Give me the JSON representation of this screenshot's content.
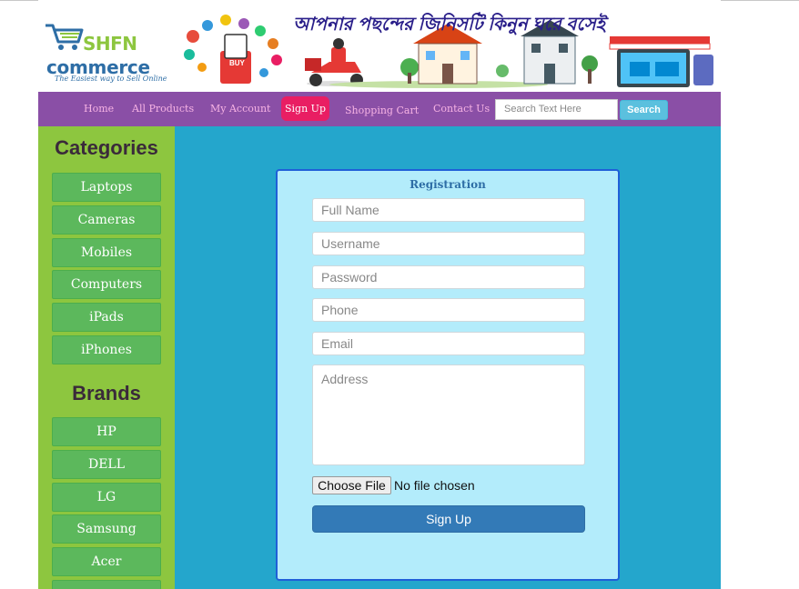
{
  "header": {
    "logo": {
      "brand_top": "SHFN",
      "brand_bottom": "commerce",
      "tagline": "The Easiest way to Sell Online"
    },
    "banner_text": "আপনার পছন্দের জিনিসটি কিনুন ঘরে বসেই"
  },
  "nav": {
    "items": [
      "Home",
      "All Products",
      "My Account",
      "Sign Up",
      "Shopping Cart",
      "Contact Us"
    ],
    "active": "Sign Up",
    "search_placeholder": "Search Text Here",
    "search_button": "Search",
    "colors": {
      "bar": "#8a4fa6",
      "link": "#f7b3e4",
      "active": "#e91e63"
    }
  },
  "sidebar": {
    "categories_heading": "Categories",
    "categories": [
      "Laptops",
      "Cameras",
      "Mobiles",
      "Computers",
      "iPads",
      "iPhones"
    ],
    "brands_heading": "Brands",
    "brands": [
      "HP",
      "DELL",
      "LG",
      "Samsung",
      "Acer"
    ]
  },
  "registration": {
    "title": "Registration",
    "placeholders": {
      "full_name": "Full Name",
      "username": "Username",
      "password": "Password",
      "phone": "Phone",
      "email": "Email",
      "address": "Address"
    },
    "file_button": "Choose File",
    "file_status": "No file chosen",
    "submit": "Sign Up"
  }
}
